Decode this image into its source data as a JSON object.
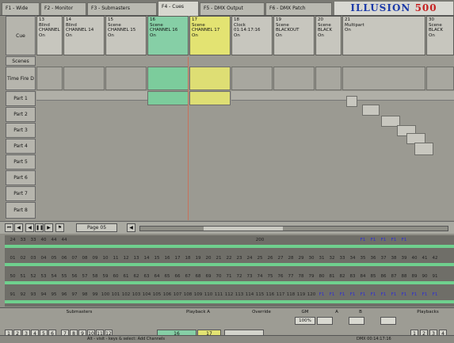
{
  "tabs": [
    "F1 - Wide",
    "F2 - Monitor",
    "F3 - Submasters",
    "F4 - Cues",
    "F5 - DMX Output",
    "F6 - DMX Patch"
  ],
  "brand": {
    "left": "ILLUSION",
    "right": "500"
  },
  "cue_label": "Cue",
  "scenes_label": "Scenes",
  "time_label": "Time\nFire D",
  "parts": [
    "Part 1",
    "Part 2",
    "Part 3",
    "Part 4",
    "Part 5",
    "Part 6",
    "Part 7",
    "Part 8"
  ],
  "cues": [
    {
      "num": "13",
      "type": "Blind",
      "name": "CHANNEL",
      "state": "On",
      "style": "plain"
    },
    {
      "num": "14",
      "type": "Blind",
      "name": "CHANNEL 14",
      "state": "On",
      "style": "plain"
    },
    {
      "num": "15",
      "type": "Scene",
      "name": "CHANNEL 15",
      "state": "On",
      "style": "plain"
    },
    {
      "num": "16",
      "type": "Scene",
      "name": "CHANNEL 16",
      "state": "On",
      "style": "green"
    },
    {
      "num": "17",
      "type": "Scene",
      "name": "CHANNEL 17",
      "state": "On",
      "style": "yellow"
    },
    {
      "num": "18",
      "type": "Clock",
      "name": "01:14:17:16",
      "state": "On",
      "style": "plain"
    },
    {
      "num": "19",
      "type": "Scene",
      "name": "BLACKOUT",
      "state": "On",
      "style": "plain"
    },
    {
      "num": "20",
      "type": "Scene",
      "name": "BLACK",
      "state": "On",
      "style": "plain"
    },
    {
      "num": "21",
      "type": "Multipart",
      "name": "",
      "state": "On",
      "style": "plain"
    },
    {
      "num": "30",
      "type": "Scene",
      "name": "BLACK",
      "state": "On",
      "style": "plain"
    }
  ],
  "scroll_label": "Page 05",
  "channels": {
    "row1": [
      "24",
      "33",
      "33",
      "40",
      "44",
      "44",
      "",
      "",
      "",
      "",
      "",
      "",
      "",
      "",
      "",
      "",
      "",
      "",
      "",
      "",
      "",
      "",
      "",
      "",
      "200",
      "",
      "",
      "",
      "",
      "",
      "",
      "",
      "",
      "",
      "F1",
      "F1",
      "F1",
      "F1",
      "F1",
      "",
      "",
      "",
      ""
    ],
    "row2": [
      "01",
      "02",
      "03",
      "04",
      "05",
      "06",
      "07",
      "08",
      "09",
      "10",
      "11",
      "12",
      "13",
      "14",
      "15",
      "16",
      "17",
      "18",
      "19",
      "20",
      "21",
      "22",
      "23",
      "24",
      "25",
      "26",
      "27",
      "28",
      "29",
      "30",
      "31",
      "32",
      "33",
      "34",
      "35",
      "36",
      "37",
      "38",
      "39",
      "40",
      "41",
      "42"
    ],
    "row3": [
      "50",
      "51",
      "52",
      "53",
      "54",
      "55",
      "56",
      "57",
      "58",
      "59",
      "60",
      "61",
      "62",
      "63",
      "64",
      "65",
      "66",
      "67",
      "68",
      "69",
      "70",
      "71",
      "72",
      "73",
      "74",
      "75",
      "76",
      "77",
      "78",
      "79",
      "80",
      "81",
      "82",
      "83",
      "84",
      "85",
      "86",
      "87",
      "88",
      "89",
      "90",
      "91"
    ],
    "row4": [
      "91",
      "92",
      "93",
      "94",
      "95",
      "96",
      "97",
      "98",
      "99",
      "100",
      "101",
      "102",
      "103",
      "104",
      "105",
      "106",
      "107",
      "108",
      "109",
      "110",
      "111",
      "112",
      "113",
      "114",
      "115",
      "116",
      "117",
      "118",
      "119",
      "120",
      "F1",
      "F1",
      "F1",
      "F1",
      "F1",
      "F1",
      "F1",
      "F1",
      "F1",
      "F1",
      "F1",
      "F1"
    ]
  },
  "bottom": {
    "sub_label": "Submasters",
    "playback_label": "Playback A",
    "override_label": "Override",
    "grand_label": "GM",
    "a_label": "A",
    "b_label": "B",
    "playback_right": "Playbacks",
    "grand_value": "100%",
    "playback_a_value": "16",
    "playback_b_value": "17",
    "subs": [
      "1",
      "2",
      "3",
      "4",
      "5",
      "6",
      "7",
      "8",
      "9",
      "10",
      "11",
      "12"
    ],
    "right_boxes": [
      "1",
      "2",
      "3",
      "4"
    ],
    "status_text": "Alt - visit - keys & select: Add Channels",
    "status_right": "DMX 00:14:17:16"
  },
  "colors": {
    "green": "#86cfa6",
    "yellow": "#e3e372",
    "brand_blue": "#1c3aa8",
    "brand_red": "#c62222"
  }
}
